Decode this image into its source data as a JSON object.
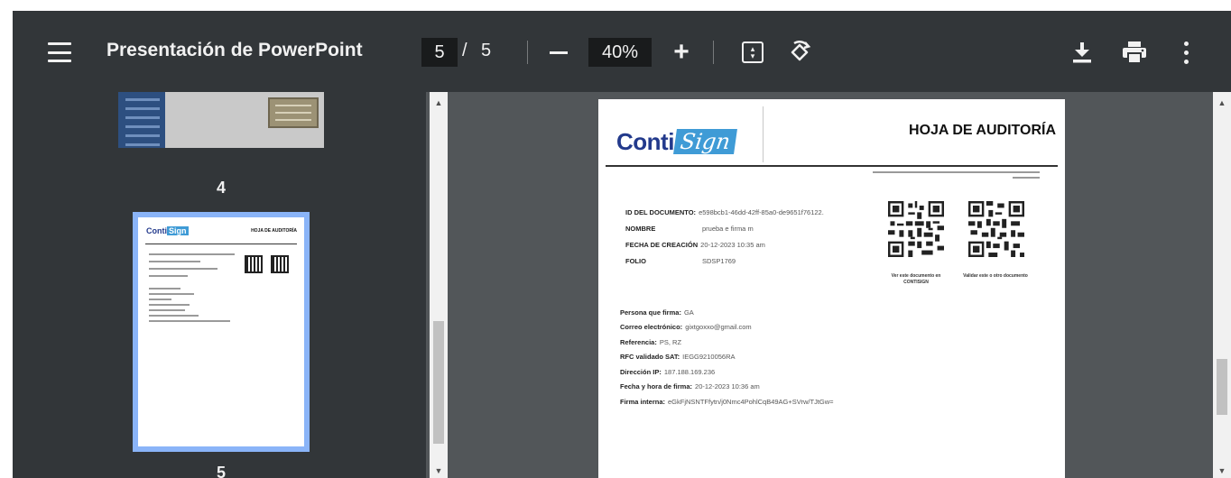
{
  "toolbar": {
    "menu_icon": "hamburger-menu-icon",
    "title": "Presentación de PowerPoint",
    "page_current": "5",
    "page_separator": "/",
    "page_total": "5",
    "zoom_out_icon": "minus-icon",
    "zoom_level": "40%",
    "zoom_in_label": "+",
    "fit_icon": "fit-to-page-icon",
    "rotate_icon": "rotate-counterclockwise-icon",
    "download_icon": "download-icon",
    "print_icon": "print-icon",
    "more_icon": "more-vert-icon"
  },
  "sidebar": {
    "thumbnails": [
      {
        "label": "4"
      },
      {
        "label": "5",
        "selected": true
      }
    ],
    "mini": {
      "logo": "Conti",
      "logo_sign": "Sign",
      "title": "HOJA DE AUDITORÍA"
    }
  },
  "document": {
    "logo_word": "Conti",
    "logo_sign": "Sign",
    "title": "HOJA DE AUDITORÍA",
    "fields": [
      {
        "label": "ID DEL DOCUMENTO:",
        "value": "e598bcb1-46dd-42ff-85a0-de9651f76122."
      },
      {
        "label": "NOMBRE",
        "value": "prueba e firma m"
      },
      {
        "label": "FECHA DE CREACIÓN",
        "value": "20-12-2023 10:35 am"
      },
      {
        "label": "FOLIO",
        "value": "SDSP1769"
      }
    ],
    "qr_captions": [
      "Ver este documento en CONTISIGN",
      "Validar este o otro documento"
    ],
    "signer": [
      {
        "label": "Persona que firma:",
        "value": "GA"
      },
      {
        "label": "Correo electrónico:",
        "value": "gixtgoxxo@gmail.com"
      },
      {
        "label": "Referencia:",
        "value": "PS, RZ"
      },
      {
        "label": "RFC validado SAT:",
        "value": "IEGG9210056RA"
      },
      {
        "label": "Dirección IP:",
        "value": "187.188.169.236"
      },
      {
        "label": "Fecha y hora de firma:",
        "value": "20-12-2023 10:36 am"
      },
      {
        "label": "Firma interna:",
        "value": "eGkFjNSNTFfytn/j0Nmc4PohlCqB49AG+SVrw/TJtGw="
      }
    ]
  },
  "colors": {
    "toolbar_bg": "#323639",
    "viewer_bg": "#525659",
    "selection": "#8ab4f8",
    "brand_blue": "#233a8c",
    "brand_light_blue": "#3f9bd6"
  }
}
